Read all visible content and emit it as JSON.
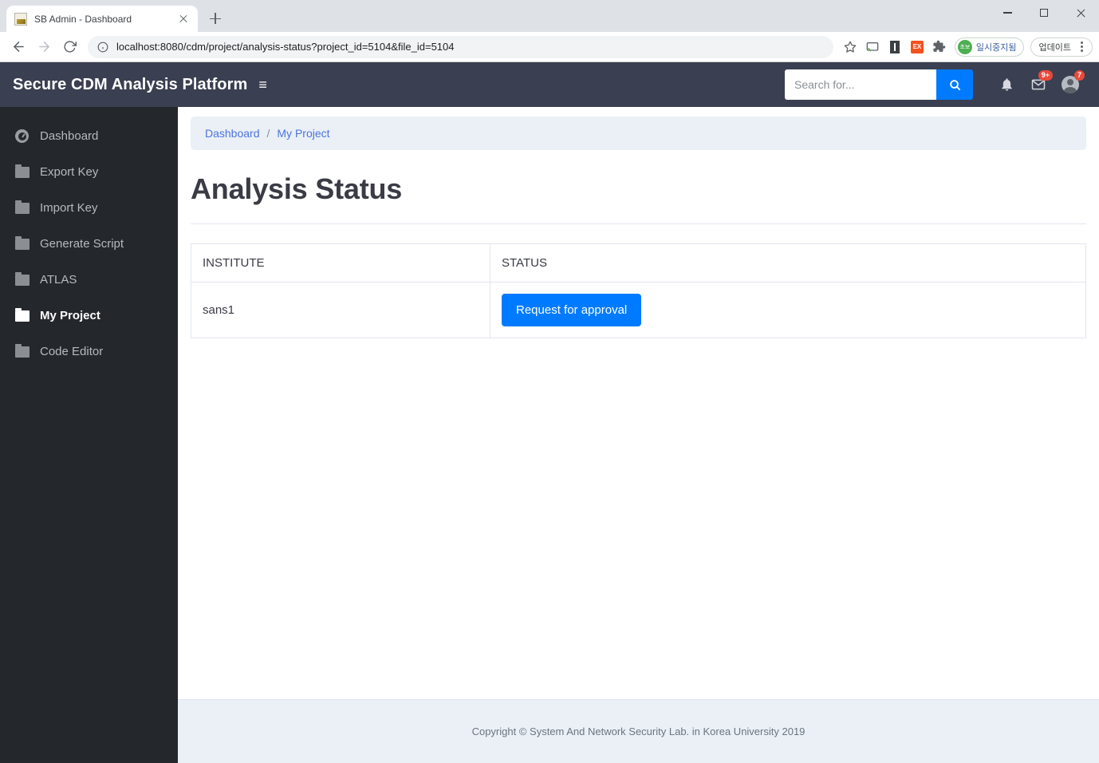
{
  "browser": {
    "tab": {
      "title": "SB Admin - Dashboard",
      "favicon_name": "sb-admin-favicon"
    },
    "new_tab_label": "+",
    "nav": {
      "back": "back-arrow",
      "forward": "forward-arrow",
      "reload": "reload-icon"
    },
    "omnibox": {
      "url": "localhost:8080/cdm/project/analysis-status?project_id=5104&file_id=5104",
      "info_icon": "site-info-icon",
      "bookmark_icon": "star-icon"
    },
    "extensions": [
      {
        "name": "cast-icon",
        "glyph": "❐"
      },
      {
        "name": "reading-list-icon",
        "glyph": "I"
      },
      {
        "name": "orange-extension-icon",
        "glyph": "EX"
      },
      {
        "name": "extensions-puzzle-icon",
        "glyph": "❖"
      }
    ],
    "profile_pill": {
      "badge": "초보",
      "text": "일시중지됨"
    },
    "update_pill": {
      "text": "업데이트",
      "menu": "kebab-menu-icon"
    },
    "window_controls": {
      "minimize": "minimize",
      "maximize": "maximize",
      "close": "close"
    }
  },
  "app": {
    "brand": "Secure CDM Analysis Platform",
    "menu_toggle": "≡",
    "search": {
      "placeholder": "Search for...",
      "value": "",
      "button_icon": "search-icon"
    },
    "alerts": {
      "icon": "bell-icon",
      "badge": ""
    },
    "messages": {
      "icon": "envelope-icon",
      "badge": "9+"
    },
    "user": {
      "icon": "user-avatar",
      "badge": "7"
    }
  },
  "sidebar": {
    "items": [
      {
        "label": "Dashboard",
        "icon": "tachometer-icon",
        "active": false
      },
      {
        "label": "Export Key",
        "icon": "folder-icon",
        "active": false
      },
      {
        "label": "Import Key",
        "icon": "folder-icon",
        "active": false
      },
      {
        "label": "Generate Script",
        "icon": "folder-icon",
        "active": false
      },
      {
        "label": "ATLAS",
        "icon": "folder-icon",
        "active": false
      },
      {
        "label": "My Project",
        "icon": "folder-open-icon",
        "active": true
      },
      {
        "label": "Code Editor",
        "icon": "folder-icon",
        "active": false
      }
    ]
  },
  "main": {
    "breadcrumb": {
      "item1": "Dashboard",
      "separator": "/",
      "item2": "My Project"
    },
    "title": "Analysis Status",
    "table": {
      "headers": {
        "institute": "INSTITUTE",
        "status": "STATUS"
      },
      "rows": [
        {
          "institute": "sans1",
          "action_label": "Request for approval"
        }
      ]
    }
  },
  "footer": {
    "copyright": "Copyright © System And Network Security Lab. in Korea University 2019"
  },
  "colors": {
    "topnav": "#3a3f51",
    "sidebar": "#24282c",
    "primary": "#007bff",
    "link": "#4e73df",
    "badge": "#e74a3b",
    "breadcrumb_bg": "#eaf0f6"
  }
}
